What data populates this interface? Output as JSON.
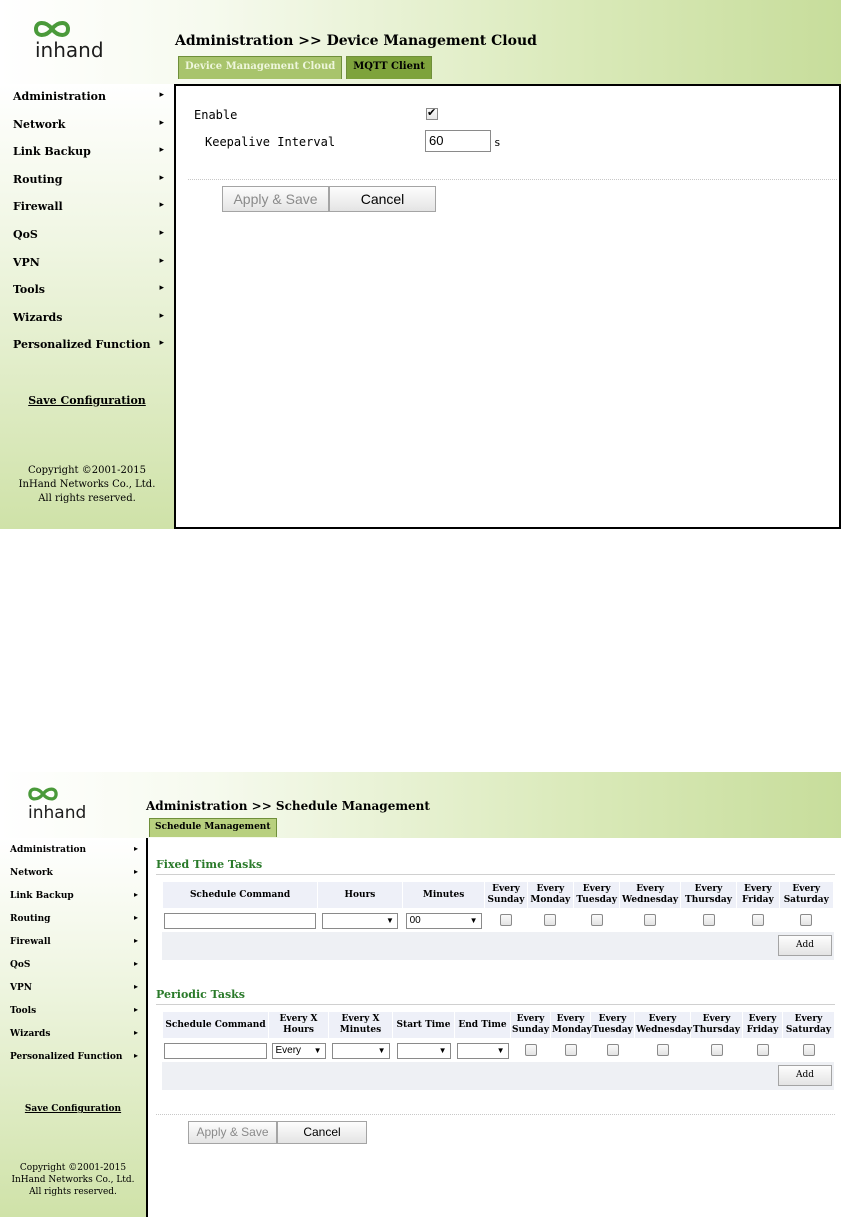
{
  "brand": {
    "logo_text": "inhand",
    "accent": "#7ea33c",
    "section_color": "#2a7a2a"
  },
  "sidebar": {
    "items": [
      {
        "label": "Administration"
      },
      {
        "label": "Network"
      },
      {
        "label": "Link Backup"
      },
      {
        "label": "Routing"
      },
      {
        "label": "Firewall"
      },
      {
        "label": "QoS"
      },
      {
        "label": "VPN"
      },
      {
        "label": "Tools"
      },
      {
        "label": "Wizards"
      },
      {
        "label": "Personalized Function"
      }
    ],
    "arrow": "▸",
    "save_configuration": "Save Configuration",
    "copyright_line1": "Copyright ©2001-2015",
    "copyright_line2": "InHand Networks Co., Ltd.",
    "copyright_line3": "All rights reserved."
  },
  "screen1": {
    "breadcrumb": "Administration >> Device Management Cloud",
    "tabs": [
      {
        "label": "Device Management Cloud",
        "active": false
      },
      {
        "label": "MQTT Client",
        "active": true
      }
    ],
    "enable_label": "Enable",
    "enable_checked": true,
    "keepalive_label": "Keepalive Interval",
    "keepalive_value": "60",
    "keepalive_unit": "s",
    "apply_save": "Apply & Save",
    "cancel": "Cancel"
  },
  "screen2": {
    "breadcrumb": "Administration >> Schedule Management",
    "tabs": [
      {
        "label": "Schedule Management",
        "active": true
      }
    ],
    "fixed_title": "Fixed Time Tasks",
    "fixed_headers": [
      "Schedule Command",
      "Hours",
      "Minutes",
      "Every Sunday",
      "Every Monday",
      "Every Tuesday",
      "Every Wednesday",
      "Every Thursday",
      "Every Friday",
      "Every Saturday"
    ],
    "fixed_hours_value": "",
    "fixed_minutes_value": "00",
    "periodic_title": "Periodic Tasks",
    "periodic_headers": [
      "Schedule Command",
      "Every X Hours",
      "Every X Minutes",
      "Start Time",
      "End Time",
      "Every Sunday",
      "Every Monday",
      "Every Tuesday",
      "Every Wednesday",
      "Every Thursday",
      "Every Friday",
      "Every Saturday"
    ],
    "periodic_every_x_hours_value": "Every",
    "add": "Add",
    "apply_save": "Apply & Save",
    "cancel": "Cancel"
  }
}
